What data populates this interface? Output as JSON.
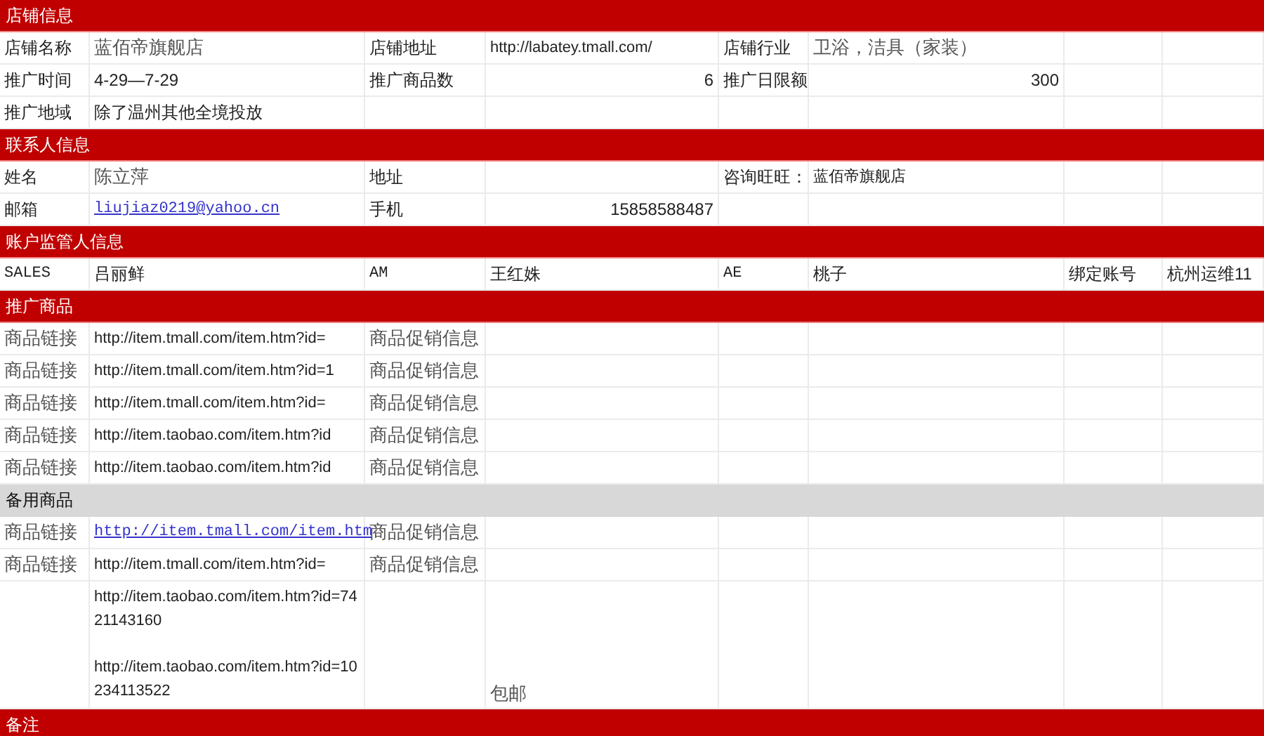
{
  "sections": [
    {
      "title": "店铺信息",
      "kind": "header",
      "rows": [
        {
          "cells": [
            {
              "text": "店铺名称"
            },
            {
              "text": "蓝佰帝旗舰店",
              "kind": "serif"
            },
            {
              "text": "店铺地址"
            },
            {
              "text": "http://labatey.tmall.com/",
              "kind": "url"
            },
            {
              "text": "店铺行业"
            },
            {
              "text": "卫浴，洁具（家装）",
              "kind": "serif"
            },
            {
              "kind": "blank"
            },
            {
              "kind": "blank"
            }
          ]
        },
        {
          "cells": [
            {
              "text": "推广时间"
            },
            {
              "text": "4-29—7-29"
            },
            {
              "text": "推广商品数"
            },
            {
              "text": "6",
              "kind": "number"
            },
            {
              "text": "推广日限额"
            },
            {
              "text": "300",
              "kind": "number"
            },
            {
              "kind": "blank"
            },
            {
              "kind": "blank"
            }
          ]
        },
        {
          "cells": [
            {
              "text": "推广地域"
            },
            {
              "text": "除了温州其他全境投放"
            },
            {
              "kind": "blank"
            },
            {
              "kind": "blank"
            },
            {
              "kind": "blank"
            },
            {
              "kind": "blank"
            },
            {
              "kind": "blank"
            },
            {
              "kind": "blank"
            }
          ]
        }
      ]
    },
    {
      "title": "联系人信息",
      "kind": "header",
      "rows": [
        {
          "cells": [
            {
              "text": "姓名"
            },
            {
              "text": "陈立萍",
              "kind": "serif"
            },
            {
              "text": "地址"
            },
            {
              "kind": "blank"
            },
            {
              "text": "咨询旺旺："
            },
            {
              "text": "蓝佰帝旗舰店",
              "kind": "small"
            },
            {
              "kind": "blank"
            },
            {
              "kind": "blank"
            }
          ]
        },
        {
          "cells": [
            {
              "text": "邮箱"
            },
            {
              "text": "liujiaz0219@yahoo.cn",
              "kind": "link"
            },
            {
              "text": "手机"
            },
            {
              "text": "15858588487",
              "kind": "number"
            },
            {
              "kind": "blank"
            },
            {
              "kind": "blank"
            },
            {
              "kind": "blank"
            },
            {
              "kind": "blank"
            }
          ]
        }
      ]
    },
    {
      "title": "账户监管人信息",
      "kind": "header",
      "rows": [
        {
          "cells": [
            {
              "text": "SALES",
              "kind": "mono"
            },
            {
              "text": "吕丽鲜"
            },
            {
              "text": "AM",
              "kind": "mono"
            },
            {
              "text": "王红姝"
            },
            {
              "text": "AE",
              "kind": "mono"
            },
            {
              "text": "桃子"
            },
            {
              "text": "绑定账号"
            },
            {
              "text": "杭州运维11"
            }
          ]
        }
      ]
    },
    {
      "title": "推广商品",
      "kind": "header",
      "rows": [
        {
          "cells": [
            {
              "text": "商品链接",
              "kind": "serif"
            },
            {
              "text": "http://item.tmall.com/item.htm?id=",
              "kind": "url"
            },
            {
              "text": "商品促销信息",
              "kind": "serif"
            },
            {
              "kind": "blank"
            },
            {
              "kind": "blank"
            },
            {
              "kind": "blank"
            },
            {
              "kind": "blank"
            },
            {
              "kind": "blank"
            }
          ]
        },
        {
          "cells": [
            {
              "text": "商品链接",
              "kind": "serif"
            },
            {
              "text": "http://item.tmall.com/item.htm?id=1",
              "kind": "url"
            },
            {
              "text": "商品促销信息",
              "kind": "serif"
            },
            {
              "kind": "blank"
            },
            {
              "kind": "blank"
            },
            {
              "kind": "blank"
            },
            {
              "kind": "blank"
            },
            {
              "kind": "blank"
            }
          ]
        },
        {
          "cells": [
            {
              "text": "商品链接",
              "kind": "serif"
            },
            {
              "text": "http://item.tmall.com/item.htm?id=",
              "kind": "url"
            },
            {
              "text": "商品促销信息",
              "kind": "serif"
            },
            {
              "kind": "blank"
            },
            {
              "kind": "blank"
            },
            {
              "kind": "blank"
            },
            {
              "kind": "blank"
            },
            {
              "kind": "blank"
            }
          ]
        },
        {
          "cells": [
            {
              "text": "商品链接",
              "kind": "serif"
            },
            {
              "text": "http://item.taobao.com/item.htm?id",
              "kind": "url"
            },
            {
              "text": "商品促销信息",
              "kind": "serif"
            },
            {
              "kind": "blank"
            },
            {
              "kind": "blank"
            },
            {
              "kind": "blank"
            },
            {
              "kind": "blank"
            },
            {
              "kind": "blank"
            }
          ]
        },
        {
          "cells": [
            {
              "text": "商品链接",
              "kind": "serif"
            },
            {
              "text": "http://item.taobao.com/item.htm?id",
              "kind": "url"
            },
            {
              "text": "商品促销信息",
              "kind": "serif"
            },
            {
              "kind": "blank"
            },
            {
              "kind": "blank"
            },
            {
              "kind": "blank"
            },
            {
              "kind": "blank"
            },
            {
              "kind": "blank"
            }
          ]
        }
      ]
    },
    {
      "title": "备用商品",
      "kind": "subheader",
      "rows": [
        {
          "cells": [
            {
              "text": "商品链接",
              "kind": "serif"
            },
            {
              "text": "http://item.tmall.com/item.htm",
              "kind": "link"
            },
            {
              "text": "商品促销信息",
              "kind": "serif"
            },
            {
              "kind": "blank"
            },
            {
              "kind": "blank"
            },
            {
              "kind": "blank"
            },
            {
              "kind": "blank"
            },
            {
              "kind": "blank"
            }
          ]
        },
        {
          "cells": [
            {
              "text": "商品链接",
              "kind": "serif"
            },
            {
              "text": "http://item.tmall.com/item.htm?id=",
              "kind": "url"
            },
            {
              "text": "商品促销信息",
              "kind": "serif"
            },
            {
              "kind": "blank"
            },
            {
              "kind": "blank"
            },
            {
              "kind": "blank"
            },
            {
              "kind": "blank"
            },
            {
              "kind": "blank"
            }
          ]
        },
        {
          "cells": [
            {
              "kind": "blank"
            },
            {
              "paragraphs": [
                "http://item.taobao.com/item.htm?id=7421143160",
                "http://item.taobao.com/item.htm?id=10234113522"
              ],
              "kind": "wrap"
            },
            {
              "kind": "blank"
            },
            {
              "text": "包邮",
              "kind": "note"
            },
            {
              "kind": "blank"
            },
            {
              "kind": "blank"
            },
            {
              "kind": "blank"
            },
            {
              "kind": "blank"
            }
          ]
        }
      ]
    },
    {
      "title": "备注",
      "kind": "header"
    }
  ]
}
